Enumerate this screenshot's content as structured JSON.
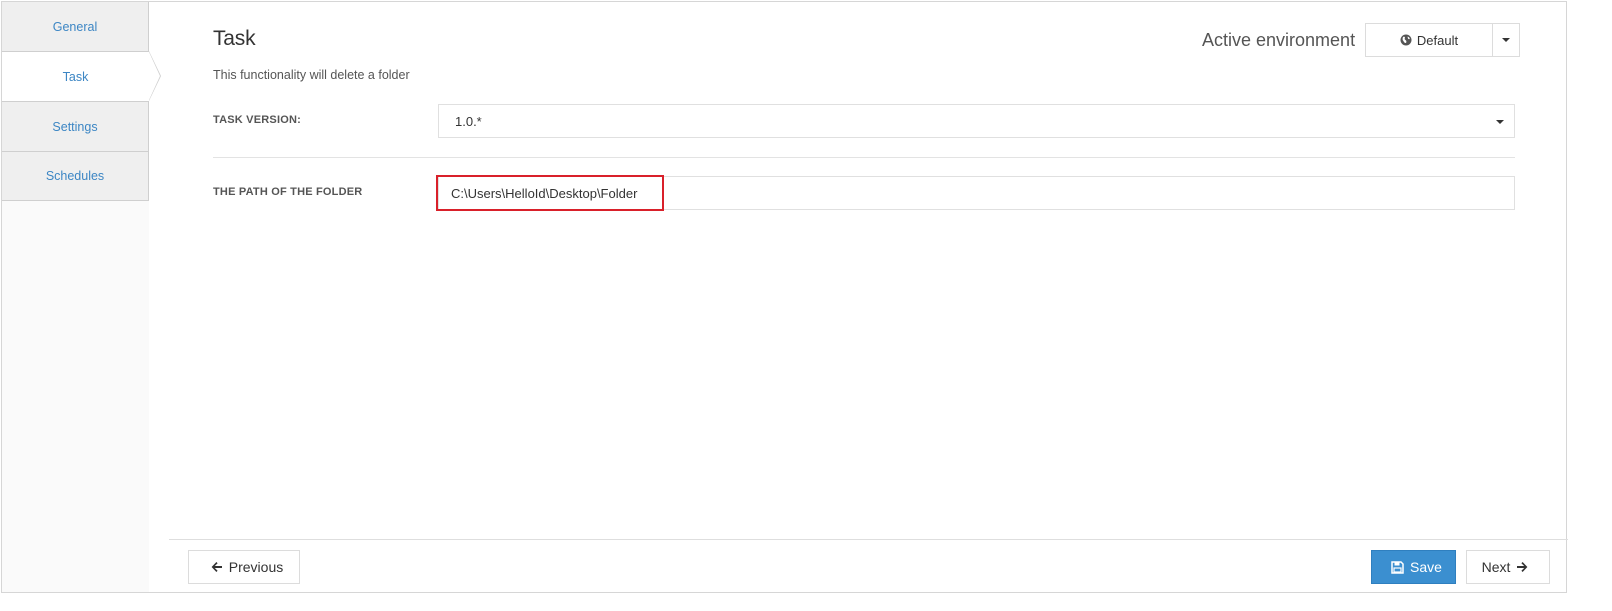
{
  "sidebar": {
    "items": [
      {
        "label": "General"
      },
      {
        "label": "Task"
      },
      {
        "label": "Settings"
      },
      {
        "label": "Schedules"
      }
    ]
  },
  "header": {
    "title": "Task",
    "subtitle": "This functionality will delete a folder",
    "environment_label": "Active environment",
    "environment_value": "Default"
  },
  "form": {
    "task_version_label": "TASK VERSION:",
    "task_version_value": "1.0.*",
    "folder_path_label": "THE PATH OF THE FOLDER",
    "folder_path_value": "C:\\Users\\HelloId\\Desktop\\Folder"
  },
  "footer": {
    "previous_label": "Previous",
    "save_label": "Save",
    "next_label": "Next"
  },
  "colors": {
    "accent": "#3b8fd0",
    "link": "#3c86c4",
    "highlight": "#d9202a"
  }
}
